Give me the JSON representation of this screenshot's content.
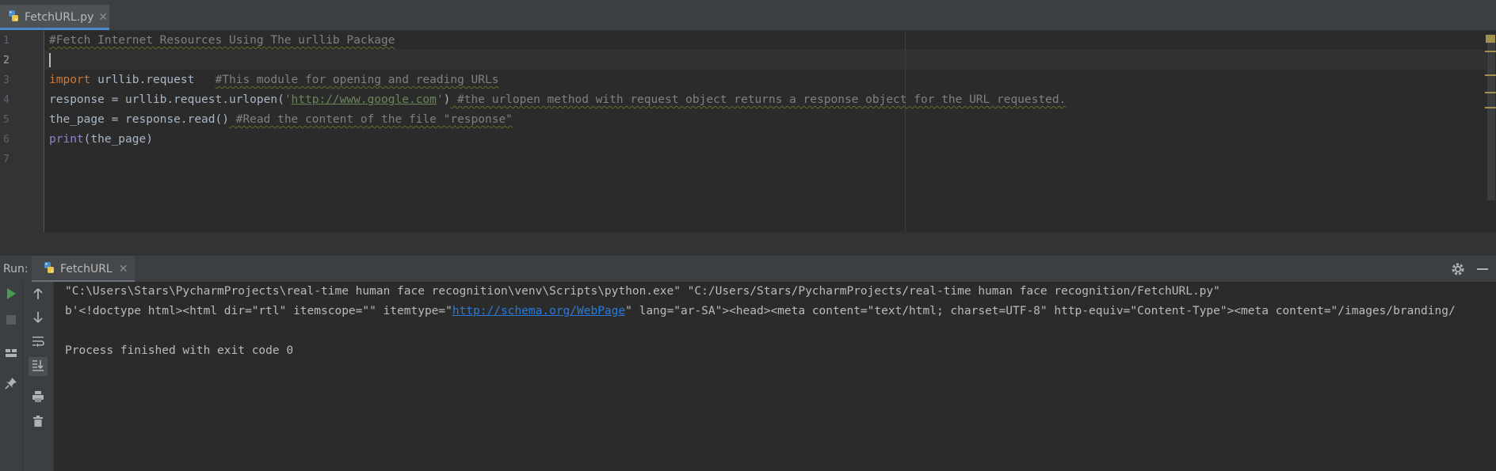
{
  "editor_tab": {
    "label": "FetchURL.py",
    "close": "✕"
  },
  "line_numbers": [
    "1",
    "2",
    "3",
    "4",
    "5",
    "6",
    "7"
  ],
  "code": {
    "l1_comment": "#Fetch Internet Resources Using The urllib Package",
    "l3_kw": "import",
    "l3_code": " urllib.request   ",
    "l3_comment": "#This module for opening and reading URLs",
    "l4_code": "response = urllib.request.urlopen(",
    "l4_quote_open": "'",
    "l4_url": "http://www.google.com",
    "l4_quote_close": "'",
    "l4_paren": ")",
    "l4_comment": " #the urlopen method with request object returns a response object for the URL requested.",
    "l5_code": "the_page = response.read()",
    "l5_comment": " #Read the content of the file \"response\"",
    "l6_fn": "print",
    "l6_code": "(the_page)"
  },
  "run": {
    "label": "Run:",
    "tab_label": "FetchURL",
    "tab_close": "✕",
    "console_line1": "\"C:\\Users\\Stars\\PycharmProjects\\real-time human face recognition\\venv\\Scripts\\python.exe\" \"C:/Users/Stars/PycharmProjects/real-time human face recognition/FetchURL.py\"",
    "console_line2_pre": "b'<!doctype html><html dir=\"rtl\" itemscope=\"\" itemtype=\"",
    "console_line2_link": "http://schema.org/WebPage",
    "console_line2_post": "\" lang=\"ar-SA\"><head><meta content=\"text/html; charset=UTF-8\" http-equiv=\"Content-Type\"><meta content=\"/images/branding/",
    "console_line4": "Process finished with exit code 0"
  },
  "icons": {
    "file": "python-file-icon",
    "run": "play-icon",
    "stop": "stop-icon",
    "up": "arrow-up-icon",
    "down": "arrow-down-icon",
    "wrap": "soft-wrap-icon",
    "scroll": "scroll-to-end-icon",
    "print": "print-icon",
    "trash": "trash-icon",
    "layout": "layout-icon",
    "pin": "pin-icon",
    "gear": "gear-icon",
    "minimize": "minimize-icon"
  },
  "colors": {
    "keyword": "#cc7832",
    "comment": "#808080",
    "string": "#6a8759",
    "link": "#287bde",
    "builtin": "#8888c6",
    "run_green": "#499c54"
  }
}
